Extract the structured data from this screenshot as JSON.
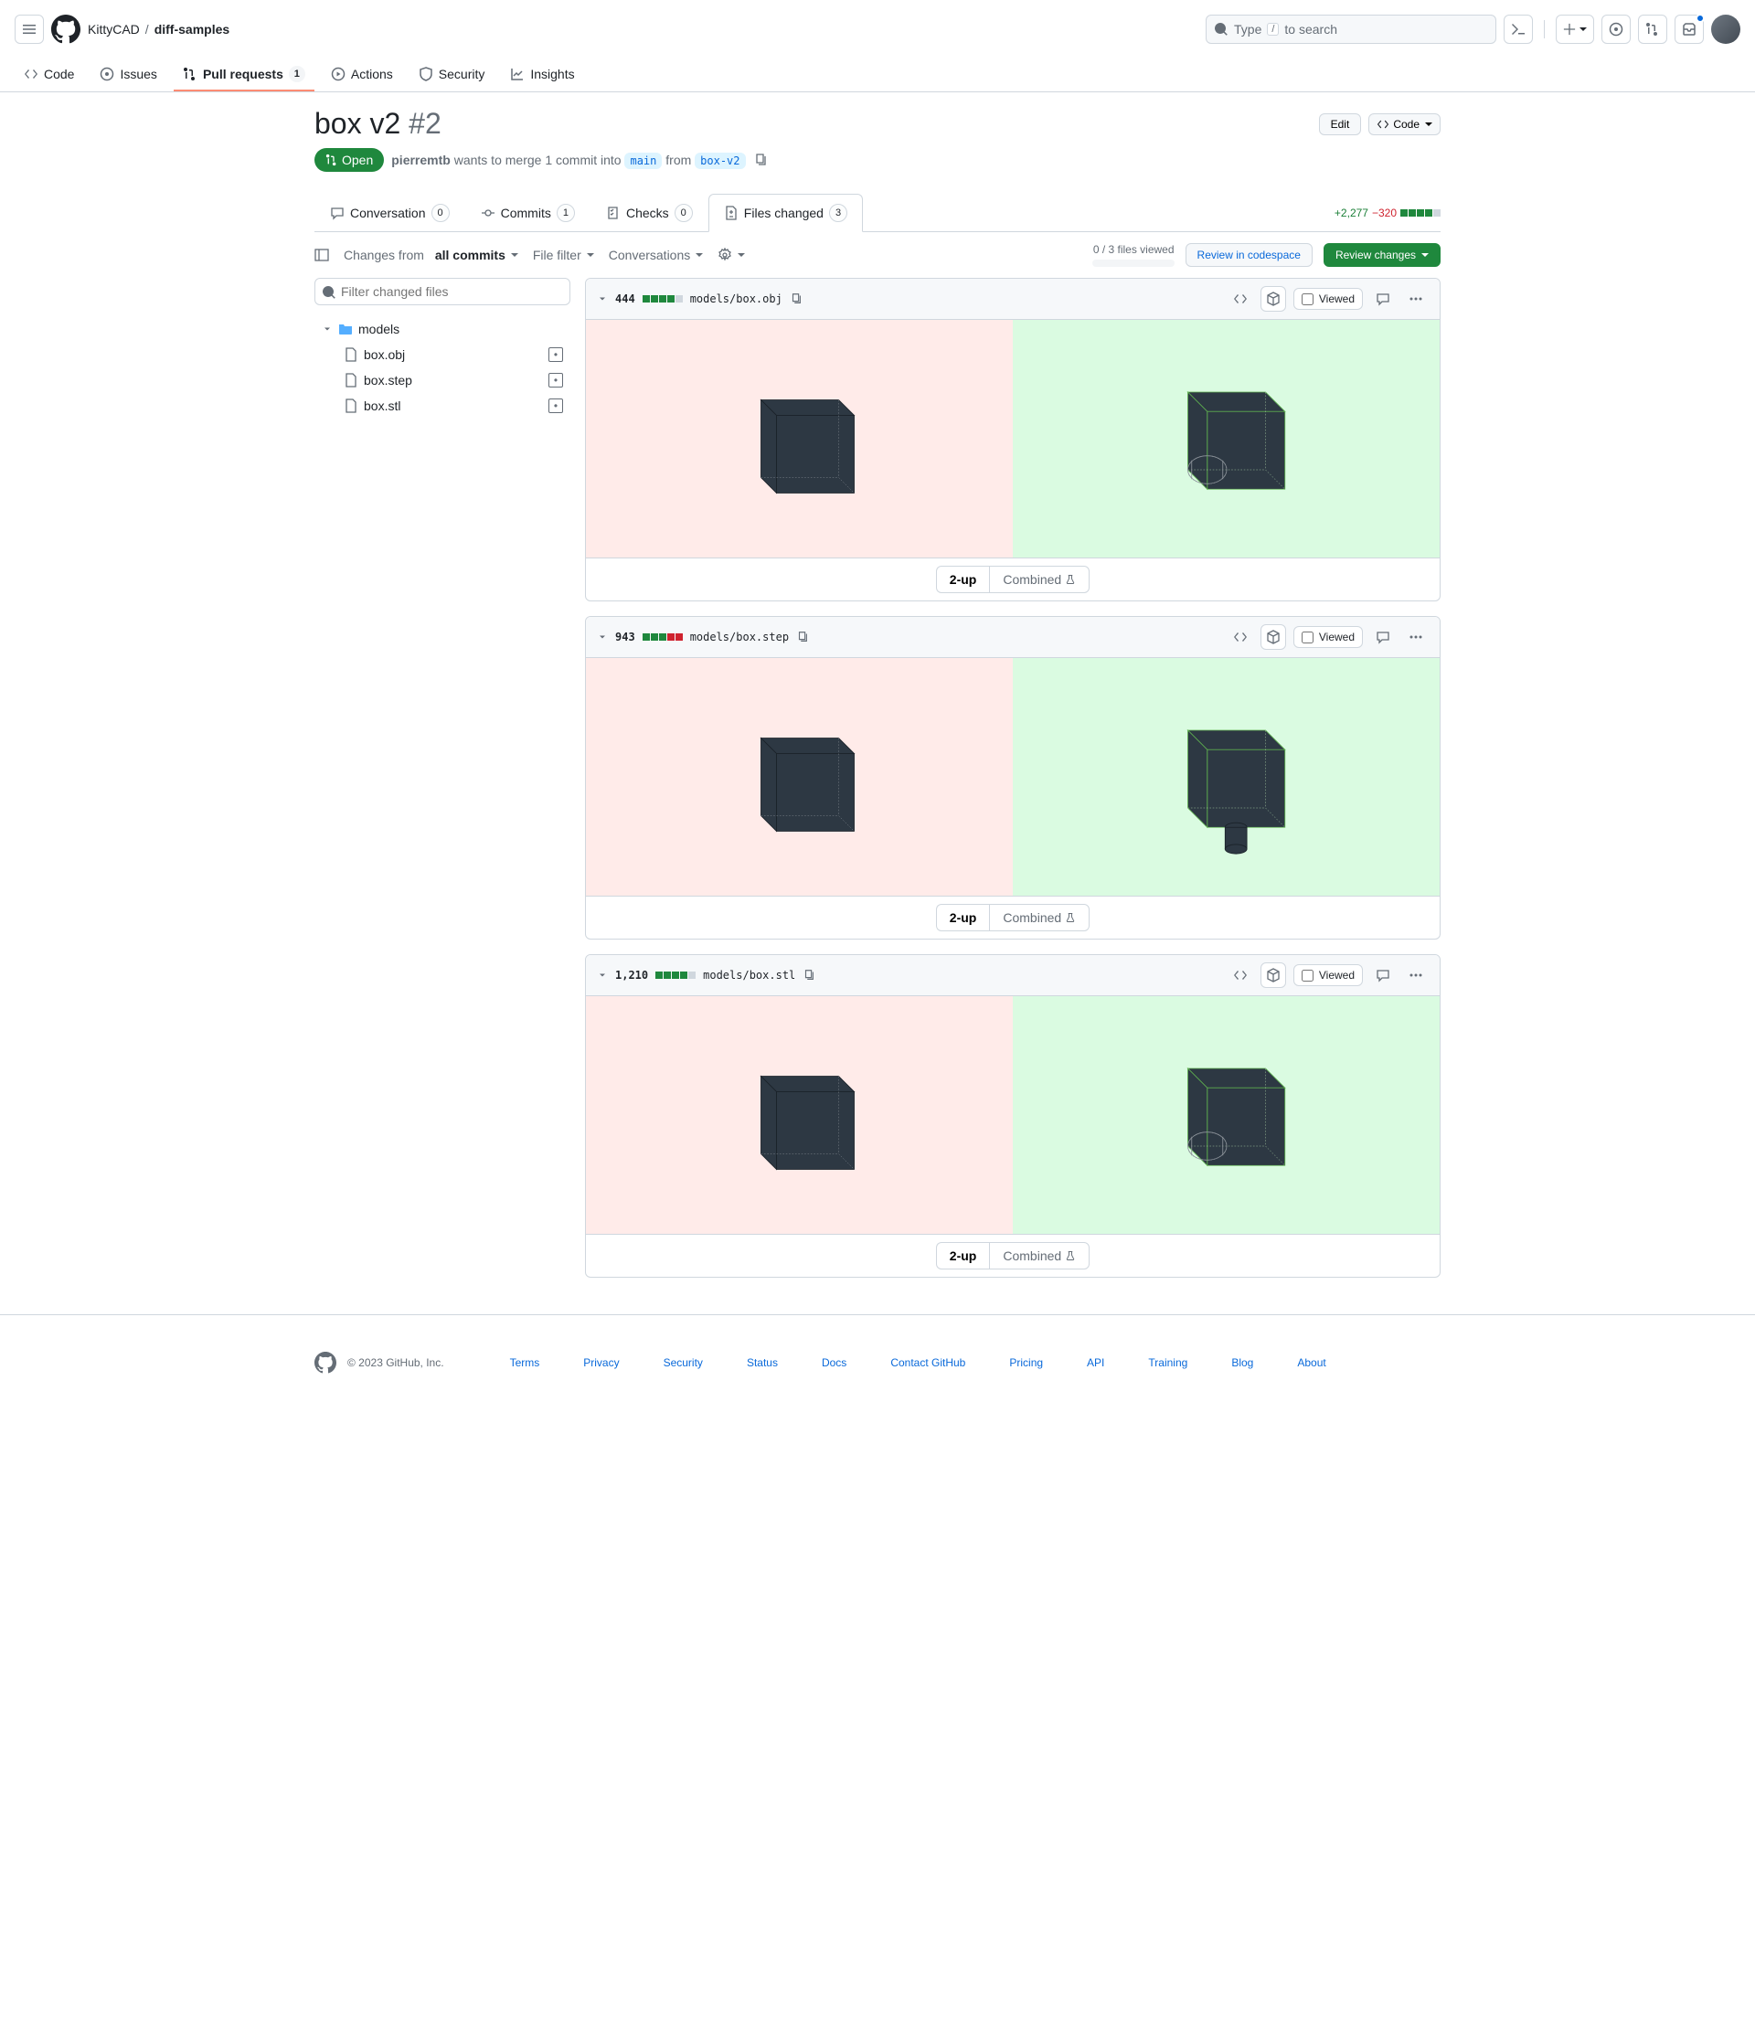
{
  "header": {
    "owner": "KittyCAD",
    "repo": "diff-samples",
    "search": {
      "placeholder": "Type",
      "suffix": "to search",
      "key": "/"
    }
  },
  "repoNav": {
    "code": "Code",
    "issues": "Issues",
    "pulls": "Pull requests",
    "pullCount": "1",
    "actions": "Actions",
    "security": "Security",
    "insights": "Insights"
  },
  "pr": {
    "title": "box v2",
    "number": "#2",
    "edit": "Edit",
    "codeBtn": "Code",
    "state": "Open",
    "author": "pierremtb",
    "mergeText1": "wants to merge 1 commit into",
    "base": "main",
    "mergeText2": "from",
    "head": "box-v2"
  },
  "tabs": {
    "conversation": "Conversation",
    "conversationCount": "0",
    "commits": "Commits",
    "commitsCount": "1",
    "checks": "Checks",
    "checksCount": "0",
    "files": "Files changed",
    "filesCount": "3",
    "additions": "+2,277",
    "deletions": "−320"
  },
  "toolbar": {
    "changesFrom": "Changes from",
    "allCommits": "all commits",
    "fileFilter": "File filter",
    "conversations": "Conversations",
    "viewed": "0 / 3 files viewed",
    "reviewCodespace": "Review in codespace",
    "reviewChanges": "Review changes"
  },
  "tree": {
    "filterPlaceholder": "Filter changed files",
    "folder": "models",
    "files": [
      "box.obj",
      "box.step",
      "box.stl"
    ]
  },
  "diffs": [
    {
      "count": "444",
      "blocks": [
        "a",
        "a",
        "a",
        "a",
        "n"
      ],
      "path": "models/box.obj"
    },
    {
      "count": "943",
      "blocks": [
        "a",
        "a",
        "a",
        "d",
        "d"
      ],
      "path": "models/box.step"
    },
    {
      "count": "1,210",
      "blocks": [
        "a",
        "a",
        "a",
        "a",
        "n"
      ],
      "path": "models/box.stl"
    }
  ],
  "viewToggle": {
    "twoUp": "2-up",
    "combined": "Combined"
  },
  "viewedLabel": "Viewed",
  "footer": {
    "copyright": "© 2023 GitHub, Inc.",
    "links": [
      "Terms",
      "Privacy",
      "Security",
      "Status",
      "Docs",
      "Contact GitHub",
      "Pricing",
      "API",
      "Training",
      "Blog",
      "About"
    ]
  }
}
